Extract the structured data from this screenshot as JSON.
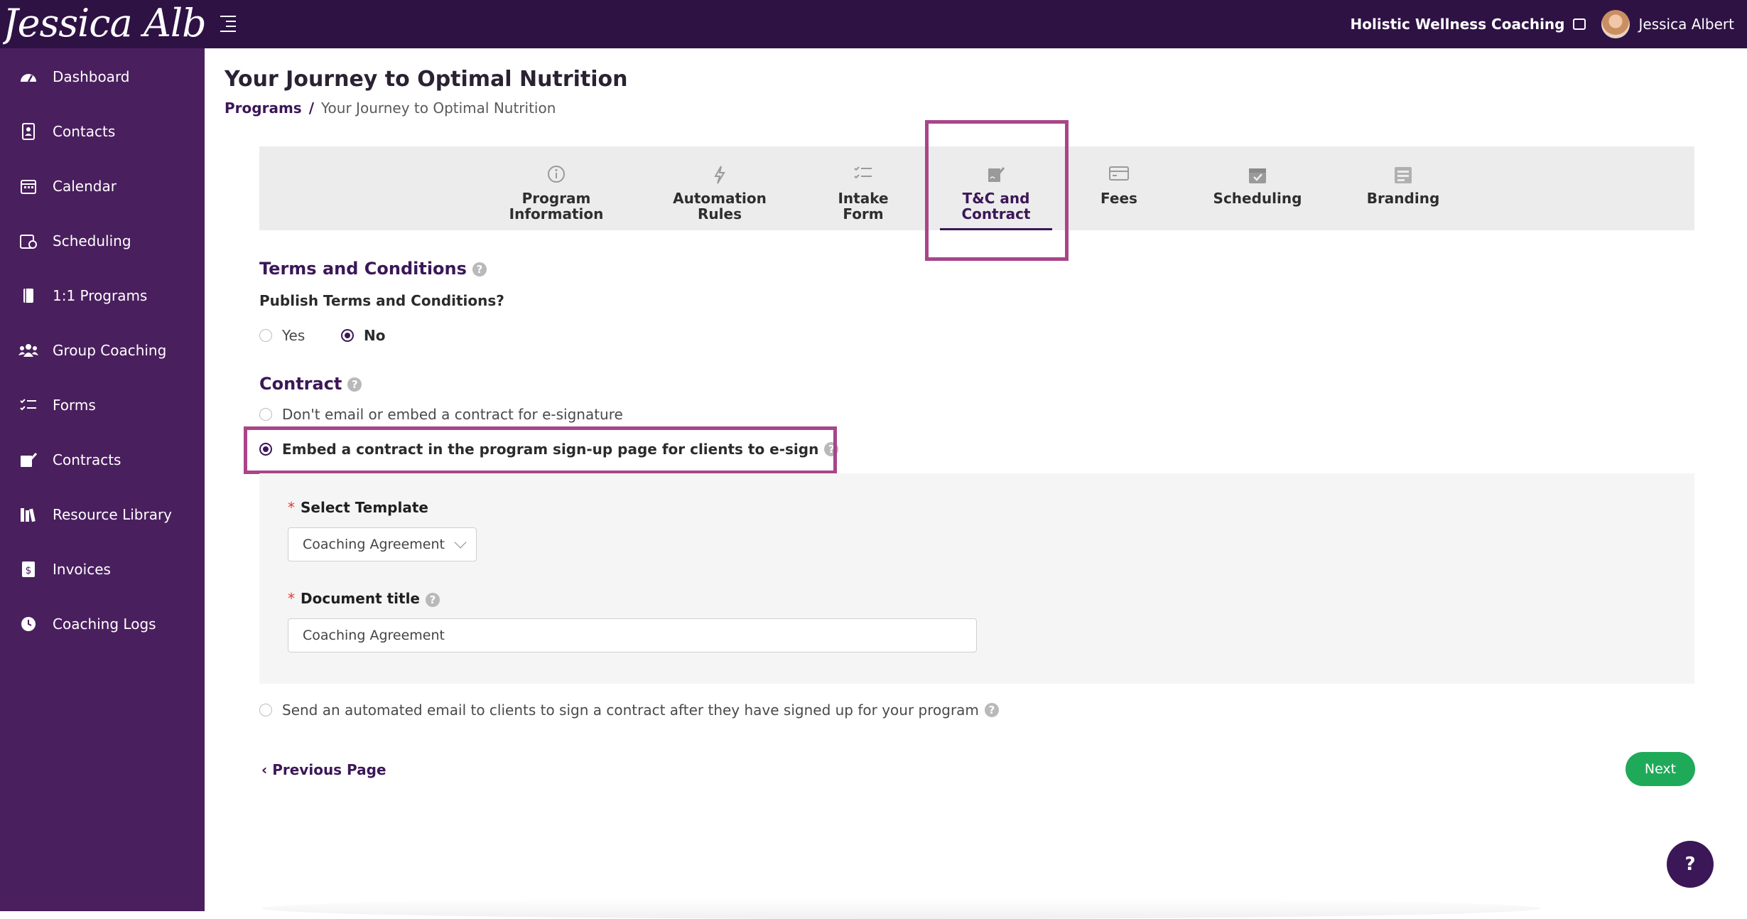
{
  "header": {
    "logo_text": "Jessica Albert",
    "business_name": "Holistic Wellness Coaching",
    "user_name": "Jessica Albert"
  },
  "sidebar": {
    "items": [
      {
        "label": "Dashboard",
        "icon": "dashboard-icon"
      },
      {
        "label": "Contacts",
        "icon": "contacts-icon"
      },
      {
        "label": "Calendar",
        "icon": "calendar-icon"
      },
      {
        "label": "Scheduling",
        "icon": "scheduling-icon"
      },
      {
        "label": "1:1 Programs",
        "icon": "book-icon"
      },
      {
        "label": "Group Coaching",
        "icon": "group-icon"
      },
      {
        "label": "Forms",
        "icon": "forms-icon"
      },
      {
        "label": "Contracts",
        "icon": "contract-icon"
      },
      {
        "label": "Resource Library",
        "icon": "library-icon"
      },
      {
        "label": "Invoices",
        "icon": "invoice-icon"
      },
      {
        "label": "Coaching Logs",
        "icon": "clock-icon"
      }
    ]
  },
  "page": {
    "title": "Your Journey to Optimal Nutrition",
    "breadcrumb_root": "Programs",
    "breadcrumb_separator": "/",
    "breadcrumb_current": "Your Journey to Optimal Nutrition"
  },
  "tabs": [
    {
      "line1": "Program",
      "line2": "Information",
      "icon": "info-icon"
    },
    {
      "line1": "Automation",
      "line2": "Rules",
      "icon": "lightning-icon"
    },
    {
      "line1": "Intake",
      "line2": "Form",
      "icon": "checklist-icon"
    },
    {
      "line1": "T&C and",
      "line2": "Contract",
      "icon": "signature-icon",
      "active": true
    },
    {
      "line1": "Fees",
      "line2": "",
      "icon": "card-icon"
    },
    {
      "line1": "Scheduling",
      "line2": "",
      "icon": "calendar-check-icon"
    },
    {
      "line1": "Branding",
      "line2": "",
      "icon": "branding-icon"
    }
  ],
  "terms": {
    "title": "Terms and Conditions",
    "question": "Publish Terms and Conditions?",
    "options": [
      "Yes",
      "No"
    ],
    "selected": "No"
  },
  "contract": {
    "title": "Contract",
    "option_none": "Don't email or embed a contract for e-signature",
    "option_embed": "Embed a contract in the program sign-up page for clients to e-sign",
    "option_email": "Send an automated email to clients to sign a contract after they have signed up for your program",
    "selected": "embed",
    "select_template_label": "Select Template",
    "select_template_value": "Coaching Agreement",
    "doc_title_label": "Document title",
    "doc_title_value": "Coaching Agreement"
  },
  "footer": {
    "previous_label": "Previous Page",
    "next_label": "Next",
    "help_label": "?"
  },
  "colors": {
    "topbar": "#2e1244",
    "sidebar": "#4a1f5e",
    "accent": "#3b1757",
    "highlight": "#a94589",
    "next_button": "#1faa5a"
  }
}
